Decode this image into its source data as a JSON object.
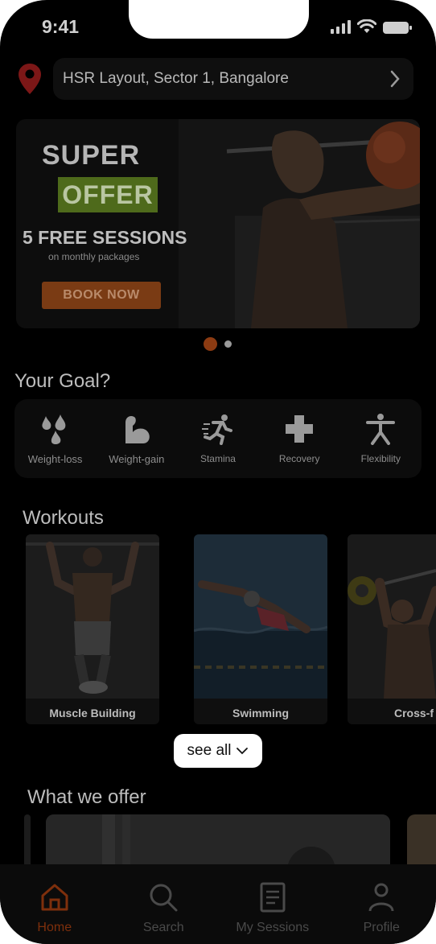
{
  "status": {
    "time": "9:41"
  },
  "location": {
    "address": "HSR Layout, Sector 1, Bangalore"
  },
  "banner": {
    "line1": "SUPER",
    "line2": "OFFER",
    "headline": "5 FREE SESSIONS",
    "subline": "on monthly packages",
    "cta": "BOOK NOW",
    "pages": 2,
    "active_page": 1
  },
  "goals": {
    "title": "Your Goal?",
    "items": [
      {
        "label": "Weight-loss",
        "icon": "drops-icon"
      },
      {
        "label": "Weight-gain",
        "icon": "flexed-arm-icon"
      },
      {
        "label": "Stamina",
        "icon": "runner-icon"
      },
      {
        "label": "Recovery",
        "icon": "plus-cross-icon"
      },
      {
        "label": "Flexibility",
        "icon": "stretch-figure-icon"
      }
    ]
  },
  "workouts": {
    "title": "Workouts",
    "items": [
      {
        "label": "Muscle Building"
      },
      {
        "label": "Swimming"
      },
      {
        "label": "Cross-f"
      }
    ],
    "see_all": "see all"
  },
  "offers": {
    "title": "What we offer"
  },
  "tabbar": {
    "items": [
      {
        "label": "Home",
        "icon": "home-icon",
        "active": true
      },
      {
        "label": "Search",
        "icon": "search-icon",
        "active": false
      },
      {
        "label": "My Sessions",
        "icon": "document-icon",
        "active": false
      },
      {
        "label": "Profile",
        "icon": "user-icon",
        "active": false
      }
    ]
  },
  "colors": {
    "accent": "#8c3b12",
    "offer_green": "#4e6a1b",
    "background": "#000000"
  }
}
